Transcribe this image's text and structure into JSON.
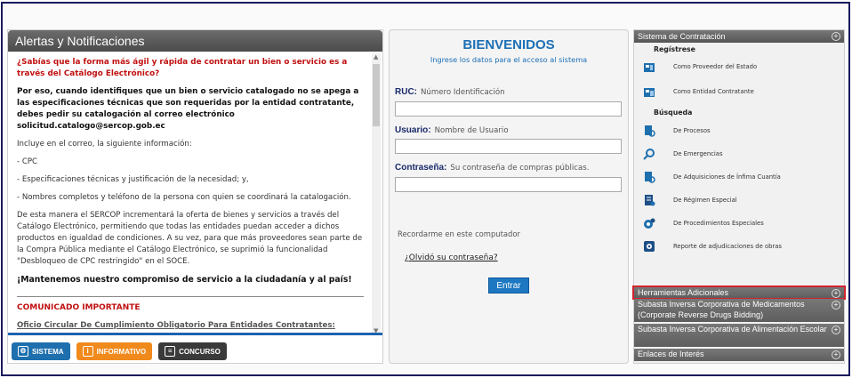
{
  "left": {
    "title": "Alertas y Notificaciones",
    "q1": "¿Sabías que la forma más ágil y rápida de contratar un bien o servicio es a través del Catálogo Electrónico?",
    "p1": "Por eso, cuando identifiques que un bien o servicio catalogado no se apega a las especificaciones técnicas que son requeridas por la entidad contratante, debes pedir su catalogación al correo electrónico solicitud.catalogo@sercop.gob.ec",
    "p2": "Incluye en el correo, la siguiente información:",
    "p3": "- CPC",
    "p4": "- Especificaciones técnicas y justificación de la necesidad; y,",
    "p5": "- Nombres completos y teléfono de la persona con quien se coordinará la catalogación.",
    "p6": "De esta manera el SERCOP incrementará la oferta de bienes y servicios a través del Catálogo Electrónico, permitiendo que todas las entidades puedan acceder a dichos productos en igualdad de condiciones. A su vez, para que más proveedores sean parte de la Compra Pública mediante el Catálogo Electrónico, se suprimió la funcionalidad \"Desbloqueo de CPC restringido\" en el SOCE.",
    "p7": "¡Mantenemos nuestro compromiso de servicio a la ciudadanía y al país!",
    "comm": "COMUNICADO IMPORTANTE",
    "circ": "Oficio Circular De Cumplimiento Obligatorio Para Entidades Contratantes: Decreto",
    "tabs": {
      "sistema": "SISTEMA",
      "informativo": "INFORMATIVO",
      "concurso": "CONCURSO"
    }
  },
  "center": {
    "title": "BIENVENIDOS",
    "subtitle": "Ingrese los datos para el acceso al sistema",
    "ruc_label": "RUC:",
    "ruc_hint": "Número Identificación",
    "user_label": "Usuario:",
    "user_hint": "Nombre de Usuario",
    "pass_label": "Contraseña:",
    "pass_hint": "Su contraseña de compras públicas.",
    "remember": "Recordarme en este computador",
    "forgot": "¿Olvidó su contraseña?",
    "enter": "Entrar"
  },
  "right": {
    "header": "Sistema de Contratación",
    "registrese": "Regístrese",
    "reg1": "Como Proveedor del Estado",
    "reg2": "Como Entidad Contratante",
    "busqueda": "Búsqueda",
    "b1": "De Procesos",
    "b2": "De Emergencias",
    "b3": "De Adquisiciones de Ínfima Cuantía",
    "b4": "De Régimen Especial",
    "b5": "De Procedimientos Especiales",
    "b6": "Reporte de adjudicaciones de obras",
    "tools": "Herramientas Adicionales",
    "sub1": "Subasta Inversa Corporativa de Medicamentos (Corporate Reverse Drugs Bidding)",
    "sub2": "Subasta Inversa Corporativa de Alimentación Escolar",
    "links": "Enlaces de Interés"
  }
}
